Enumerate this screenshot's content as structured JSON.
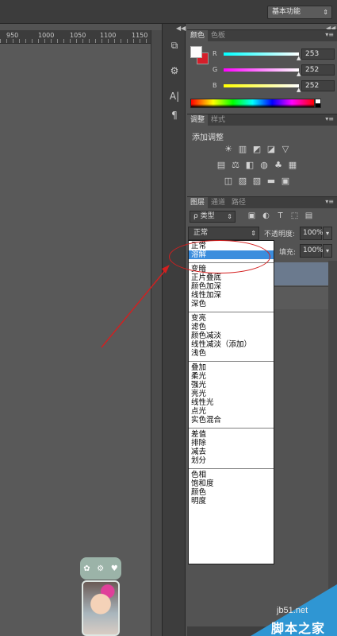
{
  "topbar": {
    "workspace": "基本功能",
    "workspace_arrow": "⇕"
  },
  "ruler": {
    "ticks": [
      "950",
      "1000",
      "1050",
      "1100",
      "1150"
    ]
  },
  "dock": {
    "collapse_left": "◀◀",
    "collapse_right": "◀◀"
  },
  "color_panel": {
    "tabs": [
      "颜色",
      "色板"
    ],
    "menu": "▾≡",
    "channels": [
      {
        "label": "R",
        "value": "253"
      },
      {
        "label": "G",
        "value": "252"
      },
      {
        "label": "B",
        "value": "252"
      }
    ],
    "foreground_color": "#fdfcfc",
    "background_color": "#d51e2a"
  },
  "adjustments_panel": {
    "tabs": [
      "调整",
      "样式"
    ],
    "menu": "▾≡",
    "title": "添加调整"
  },
  "layers_panel": {
    "tabs": [
      "图层",
      "通道",
      "路径"
    ],
    "menu": "▾≡",
    "kind_label": "ρ 类型",
    "kind_arrow": "⇕",
    "blend_mode": "正常",
    "blend_arrow": "⇕",
    "opacity_label": "不透明度:",
    "opacity_value": "100%",
    "fill_label": "填充:",
    "fill_value": "100%",
    "arrow": "▾"
  },
  "blend_menu": {
    "groups": [
      [
        "正常",
        "溶解"
      ],
      [
        "变暗",
        "正片叠底",
        "颜色加深",
        "线性加深",
        "深色"
      ],
      [
        "变亮",
        "滤色",
        "颜色减淡",
        "线性减淡（添加）",
        "浅色"
      ],
      [
        "叠加",
        "柔光",
        "强光",
        "亮光",
        "线性光",
        "点光",
        "实色混合"
      ],
      [
        "差值",
        "排除",
        "减去",
        "划分"
      ],
      [
        "色相",
        "饱和度",
        "颜色",
        "明度"
      ]
    ],
    "selected": "溶解"
  },
  "annotation": {
    "color": "#d41f1f"
  },
  "watermark": {
    "url": "jb51.net",
    "site": "脚本之家"
  }
}
